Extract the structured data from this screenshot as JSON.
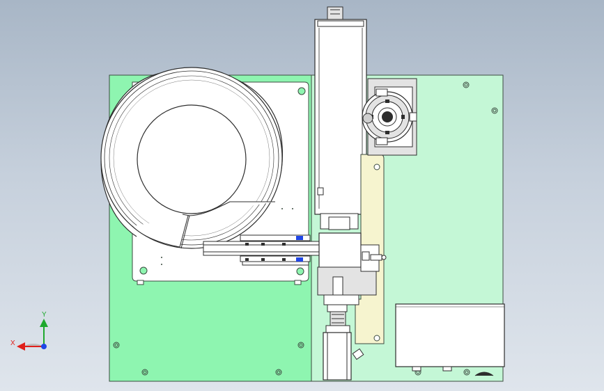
{
  "viewport": {
    "background_top": "#a8b6c6",
    "background_bottom": "#dfe5ec"
  },
  "colors": {
    "plate_green": "#8ef5b0",
    "plate_green_light": "#c4f7d6",
    "plate_outline": "#3b4a3f",
    "part_white": "#ffffff",
    "part_gray": "#e3e3e3",
    "part_dark": "#2d2d2d",
    "bracket_yellow": "#f6f4cf",
    "axis_x": "#e0201c",
    "axis_y": "#1ea82d",
    "axis_z": "#2046e6"
  },
  "triad": {
    "x_label": "X",
    "y_label": "Y"
  }
}
